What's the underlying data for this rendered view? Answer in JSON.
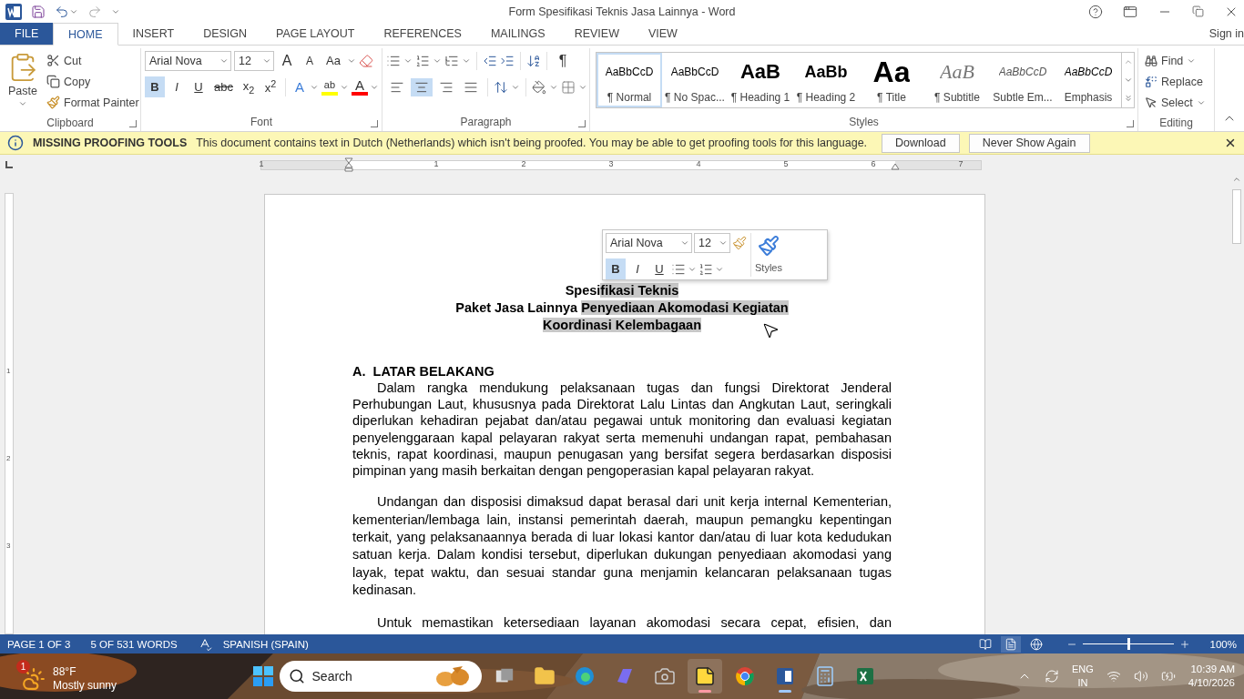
{
  "window": {
    "title": "Form Spesifikasi Teknis Jasa Lainnya - Word"
  },
  "tabs": [
    {
      "label": "FILE",
      "kind": "file",
      "selected": false
    },
    {
      "label": "HOME",
      "kind": "tab",
      "selected": true
    },
    {
      "label": "INSERT",
      "kind": "tab",
      "selected": false
    },
    {
      "label": "DESIGN",
      "kind": "tab",
      "selected": false
    },
    {
      "label": "PAGE LAYOUT",
      "kind": "tab",
      "selected": false
    },
    {
      "label": "REFERENCES",
      "kind": "tab",
      "selected": false
    },
    {
      "label": "MAILINGS",
      "kind": "tab",
      "selected": false
    },
    {
      "label": "REVIEW",
      "kind": "tab",
      "selected": false
    },
    {
      "label": "VIEW",
      "kind": "tab",
      "selected": false
    }
  ],
  "sign_in": "Sign in",
  "ribbon": {
    "clipboard": {
      "label": "Clipboard",
      "paste": "Paste",
      "items": [
        "Cut",
        "Copy",
        "Format Painter"
      ]
    },
    "font": {
      "label": "Font",
      "font_name": "Arial Nova",
      "font_size": "12",
      "grow": "A",
      "shrink": "A",
      "change_case": "Aa",
      "buttons": [
        {
          "label": "B",
          "selected": true
        },
        {
          "label": "I",
          "selected": false
        },
        {
          "label": "U",
          "selected": false
        },
        {
          "label": "abc",
          "selected": false
        },
        {
          "label": "x$_{2}$",
          "selected": false
        },
        {
          "label": "x$^{2}$",
          "selected": false
        }
      ],
      "color_buttons": [
        {
          "label": "A",
          "kind": "effects"
        },
        {
          "label": "ab",
          "kind": "highlight",
          "color": "#ffff00"
        },
        {
          "label": "A",
          "kind": "font_color",
          "color": "#ff0000"
        }
      ]
    },
    "paragraph": {
      "label": "Paragraph",
      "pilcrow": "¶",
      "align": [
        {
          "kind": "left",
          "selected": false
        },
        {
          "kind": "center",
          "selected": true
        },
        {
          "kind": "right",
          "selected": false
        },
        {
          "kind": "justify",
          "selected": false
        }
      ]
    },
    "styles": {
      "label": "Styles",
      "items": [
        {
          "preview": "AaBbCcD",
          "label": "¶ Normal",
          "kind": "normal",
          "selected": true
        },
        {
          "preview": "AaBbCcD",
          "label": "¶ No Spac...",
          "kind": "normal",
          "selected": false
        },
        {
          "preview": "AaB",
          "label": "¶ Heading 1",
          "kind": "heading1",
          "selected": false
        },
        {
          "preview": "AaBb",
          "label": "¶ Heading 2",
          "kind": "heading2",
          "selected": false
        },
        {
          "preview": "Aa",
          "label": "¶ Title",
          "kind": "title",
          "selected": false
        },
        {
          "preview": "AaB",
          "label": "¶ Subtitle",
          "kind": "subtitle",
          "selected": false
        },
        {
          "preview": "AaBbCcD",
          "label": "Subtle Em...",
          "kind": "subtle",
          "selected": false
        },
        {
          "preview": "AaBbCcD",
          "label": "Emphasis",
          "kind": "emphasis",
          "selected": false
        }
      ]
    },
    "editing": {
      "label": "Editing",
      "find": "Find",
      "replace": "Replace",
      "select": "Select"
    }
  },
  "message_bar": {
    "title": "MISSING PROOFING TOOLS",
    "text": "This document contains text in Dutch (Netherlands) which isn't being proofed. You may be able to get proofing tools for this language.",
    "buttons": [
      "Download",
      "Never Show Again"
    ]
  },
  "ruler": {
    "labels": [
      "1",
      "1",
      "2",
      "3",
      "4",
      "5",
      "6",
      "7"
    ],
    "vertical_labels": [
      "1",
      "2",
      "3"
    ]
  },
  "mini_toolbar": {
    "font_name": "Arial Nova",
    "font_size": "12",
    "styles": "Styles",
    "buttons": [
      {
        "label": "B",
        "selected": true
      },
      {
        "label": "I",
        "selected": false
      },
      {
        "label": "U",
        "selected": false
      }
    ]
  },
  "document": {
    "title_lines": [
      {
        "segments": [
          {
            "text": "Spesi",
            "selected": false
          },
          {
            "text": "fikasi Teknis",
            "selected": true
          }
        ]
      },
      {
        "segments": [
          {
            "text": "Paket Jasa Lainnya ",
            "selected": false
          },
          {
            "text": "Penyediaan Akomodasi Kegiatan ",
            "selected": true
          }
        ]
      },
      {
        "segments": [
          {
            "text": "Koordinasi Kelembagaan ",
            "selected": true
          }
        ]
      }
    ],
    "heading": "A.  LATAR BELAKANG",
    "paragraphs": [
      {
        "kind": "full",
        "text": "Dalam rangka mendukung pelaksanaan tugas dan fungsi Direktorat Jenderal Perhubungan Laut, khususnya pada Direktorat Lalu Lintas dan Angkutan Laut, seringkali diperlukan kehadiran pejabat dan/atau pegawai untuk monitoring dan evaluasi kegiatan penyelenggaraan kapal pelayaran rakyat serta memenuhi undangan rapat, pembahasan teknis, rapat koordinasi, maupun penugasan yang bersifat segera berdasarkan disposisi pimpinan yang masih berkaitan dengan pengoperasian kapal pelayaran rakyat."
      },
      {
        "kind": "full",
        "text": "Undangan dan disposisi dimaksud dapat berasal dari unit kerja internal Kementerian, kementerian/lembaga lain, instansi pemerintah daerah, maupun pemangku kepentingan terkait, yang pelaksanaannya berada di luar lokasi kantor dan/atau di luar kota kedudukan satuan kerja. Dalam kondisi tersebut, diperlukan dukungan penyediaan akomodasi yang layak, tepat waktu, dan sesuai standar guna menjamin kelancaran pelaksanaan tugas kedinasan."
      },
      {
        "kind": "partial",
        "text": "Untuk memastikan ketersediaan layanan akomodasi secara cepat, efisien, dan"
      }
    ]
  },
  "status_bar": {
    "page": "PAGE 1 OF 3",
    "words": "5 OF 531 WORDS",
    "language": "SPANISH (SPAIN)",
    "views": [
      {
        "kind": "read",
        "selected": false
      },
      {
        "kind": "print",
        "selected": true
      },
      {
        "kind": "web",
        "selected": false
      }
    ],
    "zoom": {
      "level": 0.5,
      "reading": "100%"
    }
  },
  "taskbar": {
    "weather": {
      "badge": "1",
      "temp": "88°F",
      "text": "Mostly sunny"
    },
    "search": "Search",
    "tray": {
      "lang": "ENG",
      "region": "IN",
      "time": "10:39 AM",
      "date": "4/10/2026"
    }
  }
}
